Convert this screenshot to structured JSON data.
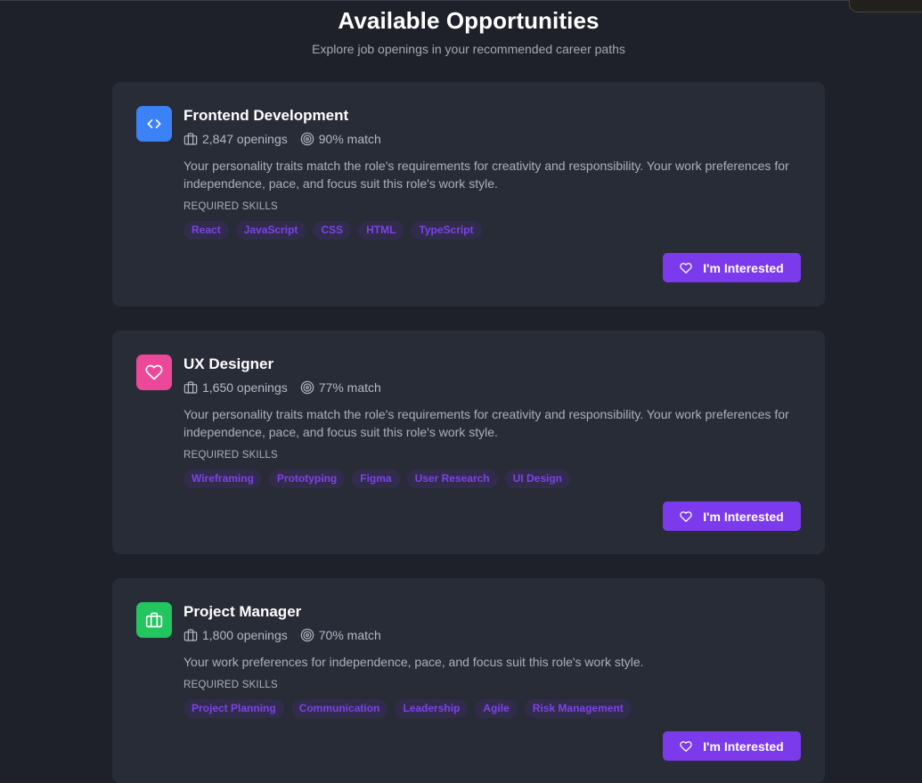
{
  "header": {
    "title": "Available Opportunities",
    "subtitle": "Explore job openings in your recommended career paths"
  },
  "cards": [
    {
      "title": "Frontend Development",
      "icon": "code-icon",
      "icon_color": "#3b82f6",
      "openings": "2,847 openings",
      "match": "90% match",
      "description": "Your personality traits match the role's requirements for creativity and responsibility. Your work preferences for independence, pace, and focus suit this role's work style.",
      "skills_label": "REQUIRED SKILLS",
      "skills": [
        "React",
        "JavaScript",
        "CSS",
        "HTML",
        "TypeScript"
      ],
      "button_label": "I'm Interested"
    },
    {
      "title": "UX Designer",
      "icon": "heart-icon",
      "icon_color": "#ec4899",
      "openings": "1,650 openings",
      "match": "77% match",
      "description": "Your personality traits match the role's requirements for creativity and responsibility. Your work preferences for independence, pace, and focus suit this role's work style.",
      "skills_label": "REQUIRED SKILLS",
      "skills": [
        "Wireframing",
        "Prototyping",
        "Figma",
        "User Research",
        "UI Design"
      ],
      "button_label": "I'm Interested"
    },
    {
      "title": "Project Manager",
      "icon": "briefcase-icon",
      "icon_color": "#22c55e",
      "openings": "1,800 openings",
      "match": "70% match",
      "description": "Your work preferences for independence, pace, and focus suit this role's work style.",
      "skills_label": "REQUIRED SKILLS",
      "skills": [
        "Project Planning",
        "Communication",
        "Leadership",
        "Agile",
        "Risk Management"
      ],
      "button_label": "I'm Interested"
    }
  ],
  "colors": {
    "background": "#1e212a",
    "card": "#282c37",
    "accent": "#7c3aed",
    "chip_bg": "#312c4b",
    "chip_text": "#7c43e8"
  }
}
